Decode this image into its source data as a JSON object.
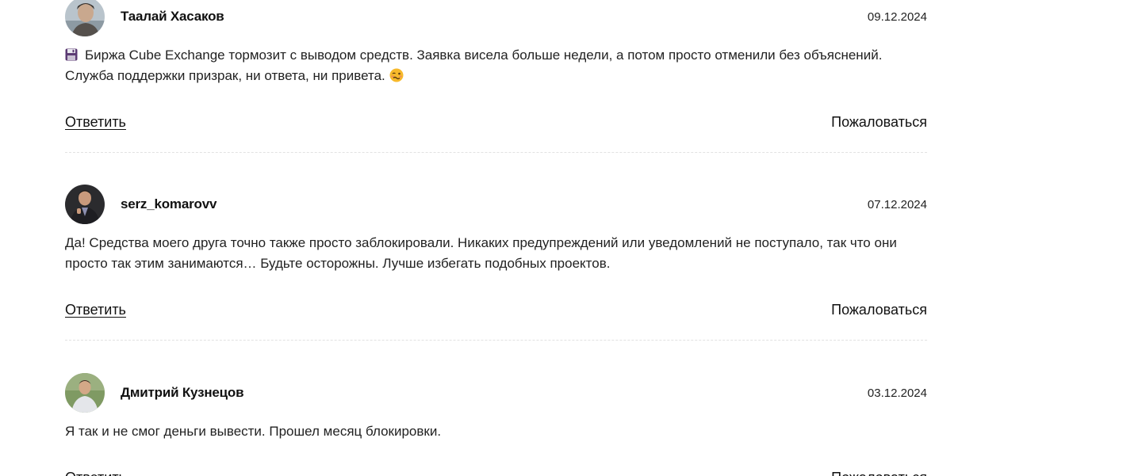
{
  "comments": [
    {
      "author": "Таалай Хасаков",
      "date": "09.12.2024",
      "avatar_icon": "user-photo",
      "leading_emoji": "floppy-disk",
      "text": "Биржа Cube Exchange тормозит с выводом средств. Заявка висела больше недели, а потом просто отменили без объяснений. Служба поддержки призрак, ни ответа, ни привета.",
      "trailing_emoji": "woozy-face",
      "reply_label": "Ответить",
      "report_label": "Пожаловаться"
    },
    {
      "author": "serz_komarovv",
      "date": "07.12.2024",
      "avatar_icon": "user-photo",
      "text": "Да! Средства моего друга точно также просто заблокировали. Никаких предупреждений или уведомлений не поступало, так что они просто так этим занимаются… Будьте осторожны. Лучше избегать подобных проектов.",
      "reply_label": "Ответить",
      "report_label": "Пожаловаться"
    },
    {
      "author": "Дмитрий Кузнецов",
      "date": "03.12.2024",
      "avatar_icon": "user-photo",
      "text": "Я так и не смог деньги вывести. Прошел месяц блокировки.",
      "reply_label": "Ответить",
      "report_label": "Пожаловаться"
    }
  ]
}
